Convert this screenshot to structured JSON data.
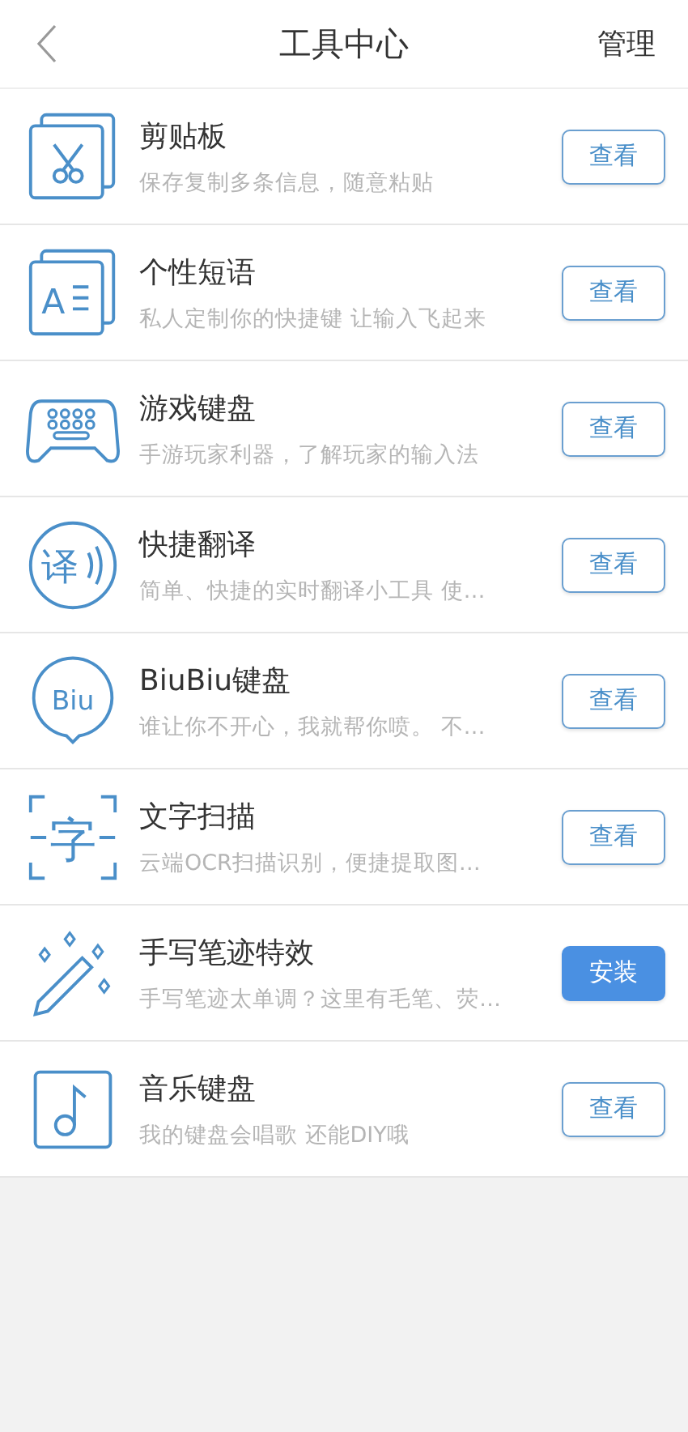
{
  "header": {
    "title": "工具中心",
    "action": "管理"
  },
  "tools": [
    {
      "kind": "scissors",
      "name": "剪贴板",
      "description": "保存复制多条信息，随意粘贴",
      "button": {
        "label": "查看",
        "primary": false
      }
    },
    {
      "kind": "text",
      "icon_text": "A",
      "name": "个性短语",
      "description": "私人定制你的快捷键 让输入飞起来",
      "button": {
        "label": "查看",
        "primary": false
      }
    },
    {
      "kind": "gamepad",
      "name": "游戏键盘",
      "description": "手游玩家利器，了解玩家的输入法",
      "button": {
        "label": "查看",
        "primary": false
      }
    },
    {
      "kind": "translate",
      "icon_text": "译",
      "name": "快捷翻译",
      "description": "简单、快捷的实时翻译小工具  使…",
      "button": {
        "label": "查看",
        "primary": false
      }
    },
    {
      "kind": "bubble",
      "icon_text": "Biu",
      "name": "BiuBiu键盘",
      "description": "谁让你不开心，我就帮你喷。 不…",
      "button": {
        "label": "查看",
        "primary": false
      }
    },
    {
      "kind": "scan",
      "icon_text": "字",
      "name": "文字扫描",
      "description": "云端OCR扫描识别，便捷提取图…",
      "button": {
        "label": "查看",
        "primary": false
      }
    },
    {
      "kind": "wand",
      "name": "手写笔迹特效",
      "description": "手写笔迹太单调？这里有毛笔、荧…",
      "button": {
        "label": "安装",
        "primary": true
      }
    },
    {
      "kind": "music",
      "name": "音乐键盘",
      "description": "我的键盘会唱歌  还能DIY哦",
      "button": {
        "label": "查看",
        "primary": false
      }
    }
  ]
}
